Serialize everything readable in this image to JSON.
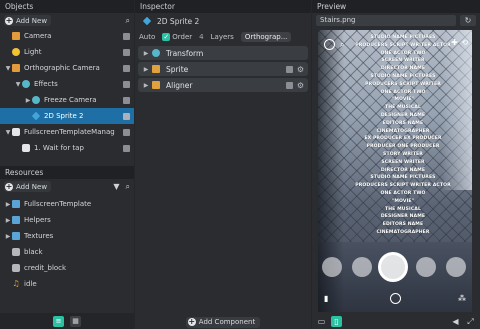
{
  "objects_panel": {
    "title": "Objects",
    "add_label": "Add New",
    "items": [
      {
        "label": "Camera",
        "icon": "camera-icon",
        "indent": 0,
        "expanded": null
      },
      {
        "label": "Light",
        "icon": "light-icon",
        "indent": 0,
        "expanded": null
      },
      {
        "label": "Orthographic Camera",
        "icon": "orthographic-camera-icon",
        "indent": 0,
        "expanded": true
      },
      {
        "label": "Effects",
        "icon": "effects-icon",
        "indent": 1,
        "expanded": true
      },
      {
        "label": "Freeze Camera",
        "icon": "freeze-camera-icon",
        "indent": 2,
        "expanded": false
      },
      {
        "label": "2D Sprite 2",
        "icon": "sprite-icon",
        "indent": 2,
        "expanded": null,
        "selected": true
      },
      {
        "label": "FullscreenTemplateManag",
        "icon": "template-manager-icon",
        "indent": 0,
        "expanded": true
      },
      {
        "label": "1. Wait for tap",
        "icon": "behavior-icon",
        "indent": 1,
        "expanded": null
      }
    ]
  },
  "resources_panel": {
    "title": "Resources",
    "add_label": "Add New",
    "items": [
      {
        "label": "FullscreenTemplate",
        "icon": "folder-icon"
      },
      {
        "label": "Helpers",
        "icon": "folder-icon"
      },
      {
        "label": "Textures",
        "icon": "folder-icon"
      },
      {
        "label": "black",
        "icon": "texture-icon"
      },
      {
        "label": "credit_block",
        "icon": "texture-icon"
      },
      {
        "label": "idle",
        "icon": "animation-icon"
      }
    ]
  },
  "inspector": {
    "title": "Inspector",
    "object_name": "2D Sprite 2",
    "tabs": {
      "auto": "Auto",
      "order": "Order",
      "order_value": "4",
      "layers": "Layers",
      "orthographic": "Orthograp..."
    },
    "components": [
      {
        "label": "Transform",
        "icon": "transform-icon"
      },
      {
        "label": "Sprite",
        "icon": "sprite-component-icon"
      },
      {
        "label": "Aligner",
        "icon": "aligner-icon"
      }
    ],
    "add_component_label": "Add Component"
  },
  "preview": {
    "title": "Preview",
    "file": "Stairs.png",
    "credits": [
      "STUDIO NAME PICTURES",
      "PRODUCERS SCRIPT WRITER ACTOR",
      "ONE ACTOR TWO",
      "SCREEN WRITER",
      "DIRECTOR NAME",
      "STUDIO NAME PICTURES",
      "PRODUCERS SCRIPT WRITER",
      "ONE ACTOR TWO",
      "\"MOVIE\"",
      "THE MUSICAL",
      "DESIGNER NAME",
      "EDITORS NAME",
      "CINEMATOGRAPHER",
      "EX PRODUCER EX PRODUCER",
      "PRODUCER ONE PRODUCER",
      "STORY WRITER",
      "SCREEN WRITER",
      "DIRECTOR NAME",
      "STUDIO NAME PICTURES",
      "PRODUCERS SCRIPT WRITER ACTOR",
      "ONE ACTOR TWO",
      "\"MOVIE\"",
      "THE MUSICAL",
      "DESIGNER NAME",
      "EDITORS NAME",
      "CINEMATOGRAPHER"
    ]
  },
  "colors": {
    "accent": "#2bc2a4",
    "selection": "#1e6fa6",
    "panel": "#2a2c30"
  }
}
